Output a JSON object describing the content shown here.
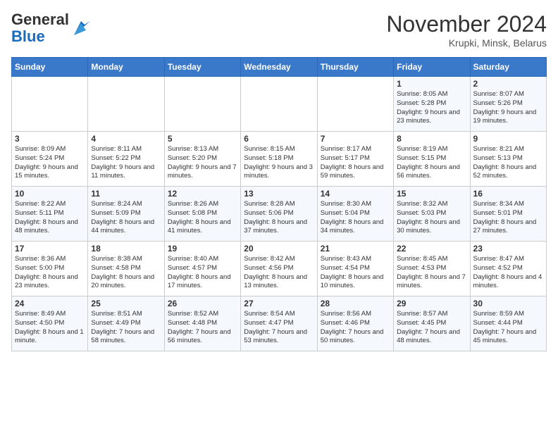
{
  "header": {
    "logo_general": "General",
    "logo_blue": "Blue",
    "month_title": "November 2024",
    "location": "Krupki, Minsk, Belarus"
  },
  "days_of_week": [
    "Sunday",
    "Monday",
    "Tuesday",
    "Wednesday",
    "Thursday",
    "Friday",
    "Saturday"
  ],
  "weeks": [
    [
      {
        "day": "",
        "info": ""
      },
      {
        "day": "",
        "info": ""
      },
      {
        "day": "",
        "info": ""
      },
      {
        "day": "",
        "info": ""
      },
      {
        "day": "",
        "info": ""
      },
      {
        "day": "1",
        "info": "Sunrise: 8:05 AM\nSunset: 5:28 PM\nDaylight: 9 hours and 23 minutes."
      },
      {
        "day": "2",
        "info": "Sunrise: 8:07 AM\nSunset: 5:26 PM\nDaylight: 9 hours and 19 minutes."
      }
    ],
    [
      {
        "day": "3",
        "info": "Sunrise: 8:09 AM\nSunset: 5:24 PM\nDaylight: 9 hours and 15 minutes."
      },
      {
        "day": "4",
        "info": "Sunrise: 8:11 AM\nSunset: 5:22 PM\nDaylight: 9 hours and 11 minutes."
      },
      {
        "day": "5",
        "info": "Sunrise: 8:13 AM\nSunset: 5:20 PM\nDaylight: 9 hours and 7 minutes."
      },
      {
        "day": "6",
        "info": "Sunrise: 8:15 AM\nSunset: 5:18 PM\nDaylight: 9 hours and 3 minutes."
      },
      {
        "day": "7",
        "info": "Sunrise: 8:17 AM\nSunset: 5:17 PM\nDaylight: 8 hours and 59 minutes."
      },
      {
        "day": "8",
        "info": "Sunrise: 8:19 AM\nSunset: 5:15 PM\nDaylight: 8 hours and 56 minutes."
      },
      {
        "day": "9",
        "info": "Sunrise: 8:21 AM\nSunset: 5:13 PM\nDaylight: 8 hours and 52 minutes."
      }
    ],
    [
      {
        "day": "10",
        "info": "Sunrise: 8:22 AM\nSunset: 5:11 PM\nDaylight: 8 hours and 48 minutes."
      },
      {
        "day": "11",
        "info": "Sunrise: 8:24 AM\nSunset: 5:09 PM\nDaylight: 8 hours and 44 minutes."
      },
      {
        "day": "12",
        "info": "Sunrise: 8:26 AM\nSunset: 5:08 PM\nDaylight: 8 hours and 41 minutes."
      },
      {
        "day": "13",
        "info": "Sunrise: 8:28 AM\nSunset: 5:06 PM\nDaylight: 8 hours and 37 minutes."
      },
      {
        "day": "14",
        "info": "Sunrise: 8:30 AM\nSunset: 5:04 PM\nDaylight: 8 hours and 34 minutes."
      },
      {
        "day": "15",
        "info": "Sunrise: 8:32 AM\nSunset: 5:03 PM\nDaylight: 8 hours and 30 minutes."
      },
      {
        "day": "16",
        "info": "Sunrise: 8:34 AM\nSunset: 5:01 PM\nDaylight: 8 hours and 27 minutes."
      }
    ],
    [
      {
        "day": "17",
        "info": "Sunrise: 8:36 AM\nSunset: 5:00 PM\nDaylight: 8 hours and 23 minutes."
      },
      {
        "day": "18",
        "info": "Sunrise: 8:38 AM\nSunset: 4:58 PM\nDaylight: 8 hours and 20 minutes."
      },
      {
        "day": "19",
        "info": "Sunrise: 8:40 AM\nSunset: 4:57 PM\nDaylight: 8 hours and 17 minutes."
      },
      {
        "day": "20",
        "info": "Sunrise: 8:42 AM\nSunset: 4:56 PM\nDaylight: 8 hours and 13 minutes."
      },
      {
        "day": "21",
        "info": "Sunrise: 8:43 AM\nSunset: 4:54 PM\nDaylight: 8 hours and 10 minutes."
      },
      {
        "day": "22",
        "info": "Sunrise: 8:45 AM\nSunset: 4:53 PM\nDaylight: 8 hours and 7 minutes."
      },
      {
        "day": "23",
        "info": "Sunrise: 8:47 AM\nSunset: 4:52 PM\nDaylight: 8 hours and 4 minutes."
      }
    ],
    [
      {
        "day": "24",
        "info": "Sunrise: 8:49 AM\nSunset: 4:50 PM\nDaylight: 8 hours and 1 minute."
      },
      {
        "day": "25",
        "info": "Sunrise: 8:51 AM\nSunset: 4:49 PM\nDaylight: 7 hours and 58 minutes."
      },
      {
        "day": "26",
        "info": "Sunrise: 8:52 AM\nSunset: 4:48 PM\nDaylight: 7 hours and 56 minutes."
      },
      {
        "day": "27",
        "info": "Sunrise: 8:54 AM\nSunset: 4:47 PM\nDaylight: 7 hours and 53 minutes."
      },
      {
        "day": "28",
        "info": "Sunrise: 8:56 AM\nSunset: 4:46 PM\nDaylight: 7 hours and 50 minutes."
      },
      {
        "day": "29",
        "info": "Sunrise: 8:57 AM\nSunset: 4:45 PM\nDaylight: 7 hours and 48 minutes."
      },
      {
        "day": "30",
        "info": "Sunrise: 8:59 AM\nSunset: 4:44 PM\nDaylight: 7 hours and 45 minutes."
      }
    ]
  ]
}
